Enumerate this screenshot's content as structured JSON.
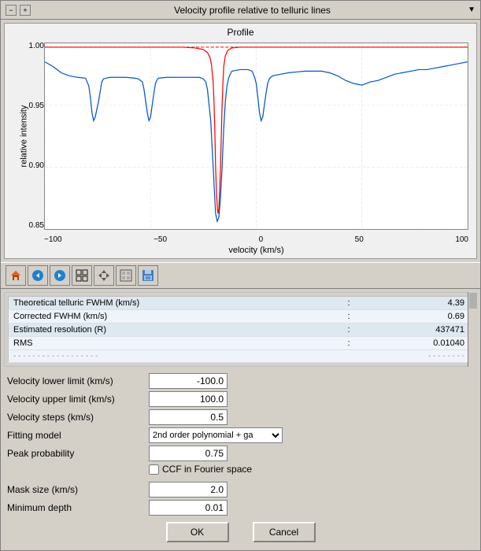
{
  "window": {
    "title": "Velocity profile relative to telluric lines",
    "controls": {
      "minimize": "−",
      "maximize": "+",
      "dropdown": "▼"
    }
  },
  "chart": {
    "title": "Profile",
    "xlabel": "velocity (km/s)",
    "ylabel": "relative intensity",
    "xmin": -100,
    "xmax": 100,
    "ymin": 0.85,
    "ymax": 1.0,
    "xticks": [
      "-100",
      "-50",
      "0",
      "50",
      "100"
    ],
    "yticks": [
      "1.00",
      "0.95",
      "0.90",
      "0.85"
    ]
  },
  "toolbar": {
    "buttons": [
      "home",
      "back",
      "forward",
      "zoom",
      "pan",
      "image",
      "save"
    ]
  },
  "table": {
    "rows": [
      {
        "label": "Theoretical telluric FWHM (km/s)",
        "colon": ":",
        "value": "4.39"
      },
      {
        "label": "Corrected FWHM (km/s)",
        "colon": ":",
        "value": "0.69"
      },
      {
        "label": "Estimated resolution (R)",
        "colon": ":",
        "value": "437471"
      },
      {
        "label": "RMS",
        "colon": ":",
        "value": "0.01040"
      },
      {
        "label": "- - - - - - - - - - - - - - - - - -",
        "colon": "",
        "value": "- - - - - - - -"
      }
    ]
  },
  "form": {
    "velocity_lower_label": "Velocity lower limit (km/s)",
    "velocity_lower_value": "-100.0",
    "velocity_upper_label": "Velocity upper limit (km/s)",
    "velocity_upper_value": "100.0",
    "velocity_steps_label": "Velocity steps (km/s)",
    "velocity_steps_value": "0.5",
    "fitting_model_label": "Fitting model",
    "fitting_model_value": "2nd order polynomial + ga",
    "peak_probability_label": "Peak probability",
    "peak_probability_value": "0.75",
    "ccf_label": "CCF in Fourier space",
    "mask_size_label": "Mask size (km/s)",
    "mask_size_value": "2.0",
    "minimum_depth_label": "Minimum depth",
    "minimum_depth_value": "0.01"
  },
  "buttons": {
    "ok": "OK",
    "cancel": "Cancel"
  }
}
